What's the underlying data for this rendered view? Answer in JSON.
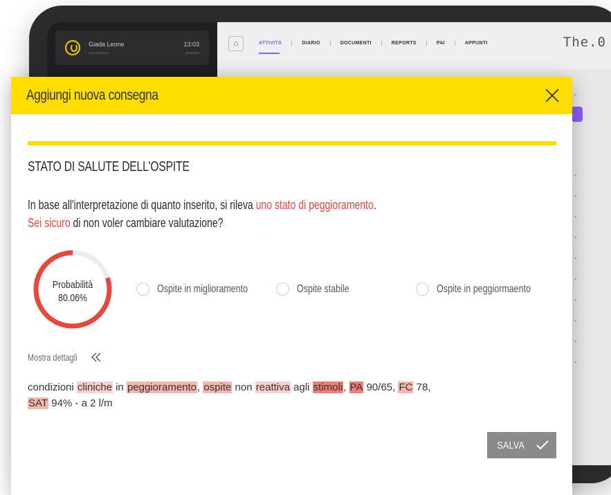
{
  "app": {
    "user_name": "Giada Leone",
    "user_role": "INFERMIERE",
    "time": "13:03",
    "date": "25/10/2022",
    "brand": "The.0",
    "nav_tabs": [
      "ATTIVITÀ",
      "DIARIO",
      "DOCUMENTI",
      "REPORTS",
      "PAI",
      "APPUNTI"
    ]
  },
  "modal": {
    "title": "Aggiungi nuova consegna",
    "section_title": "STATO DI SALUTE DELL'OSPITE",
    "message": {
      "line1_prefix": "In base all'interpretazione di quanto inserito, si rileva ",
      "line1_highlight": "uno stato di peggioramento",
      "line1_suffix": ".",
      "line2_highlight": "Sei sicuro",
      "line2_suffix": " di non voler cambiare valutazione?"
    },
    "probability": {
      "label": "Probabilità",
      "value_text": "80.06%",
      "value": 80.06
    },
    "options": [
      {
        "label": "Ospite in miglioramento",
        "selected": false
      },
      {
        "label": "Ospite stabile",
        "selected": false
      },
      {
        "label": "Ospite in peggiormaento",
        "selected": false
      }
    ],
    "details_toggle": "Mostra dettagli",
    "notes": {
      "t1": "condizioni ",
      "h1": "cliniche",
      "t2": " in ",
      "h2": "peggioramento",
      "t3": ", ",
      "h3": "ospite",
      "t4": " non ",
      "h4": "reattiva",
      "t5": " agli ",
      "h5": "stimoli",
      "t6": ", ",
      "h6": "PA",
      "t7": " 90/65, ",
      "h7": "FC",
      "t8": " 78, ",
      "h8": "SAT",
      "t9": " 94% - a 2 l/m"
    },
    "save_label": "SALVA"
  },
  "colors": {
    "header_yellow": "#fedd00",
    "accent_red": "#e8473d",
    "tab_active": "#8b5cf6",
    "button_gray": "#8a8a8a"
  }
}
